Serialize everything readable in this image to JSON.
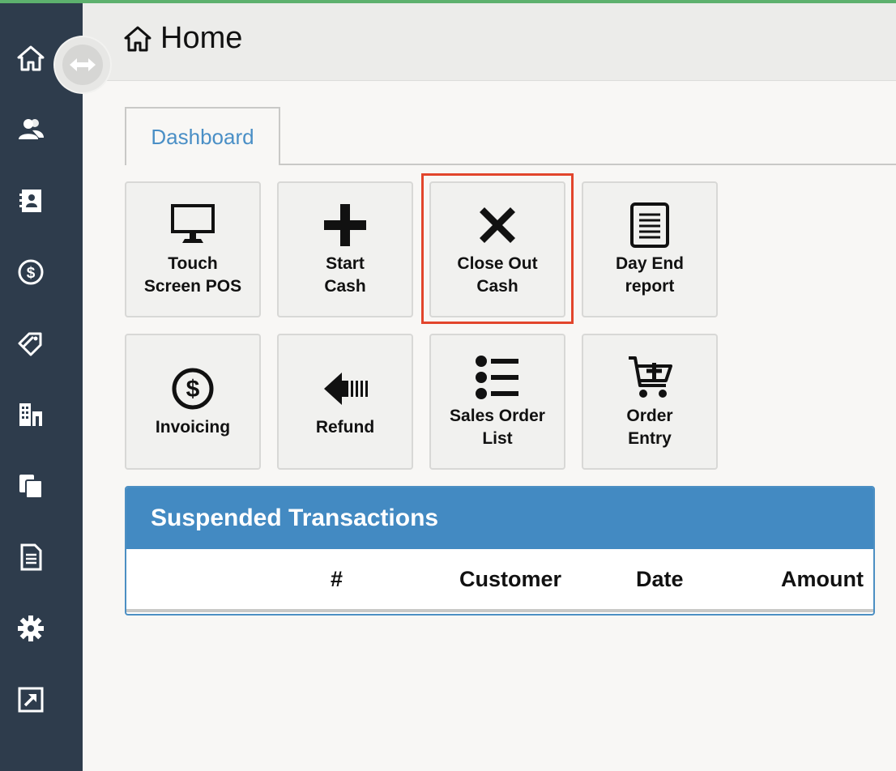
{
  "header": {
    "title": "Home"
  },
  "tabs": [
    {
      "label": "Dashboard"
    }
  ],
  "tiles": [
    {
      "label": "Touch\nScreen POS",
      "icon": "monitor-icon"
    },
    {
      "label": "Start\nCash",
      "icon": "plus-icon"
    },
    {
      "label": "Close Out\nCash",
      "icon": "x-icon"
    },
    {
      "label": "Day End\nreport",
      "icon": "document-icon"
    },
    {
      "label": "Invoicing",
      "icon": "dollar-circle-icon"
    },
    {
      "label": "Refund",
      "icon": "arrow-left-icon"
    },
    {
      "label": "Sales Order\nList",
      "icon": "list-icon"
    },
    {
      "label": "Order\nEntry",
      "icon": "cart-plus-icon"
    }
  ],
  "suspended": {
    "title": "Suspended Transactions",
    "columns": [
      "#",
      "Customer",
      "Date",
      "Amount"
    ]
  },
  "colors": {
    "accent": "#438ac2",
    "sidebar": "#2e3c4c",
    "highlight": "#e2452c",
    "topline": "#5db16e"
  }
}
